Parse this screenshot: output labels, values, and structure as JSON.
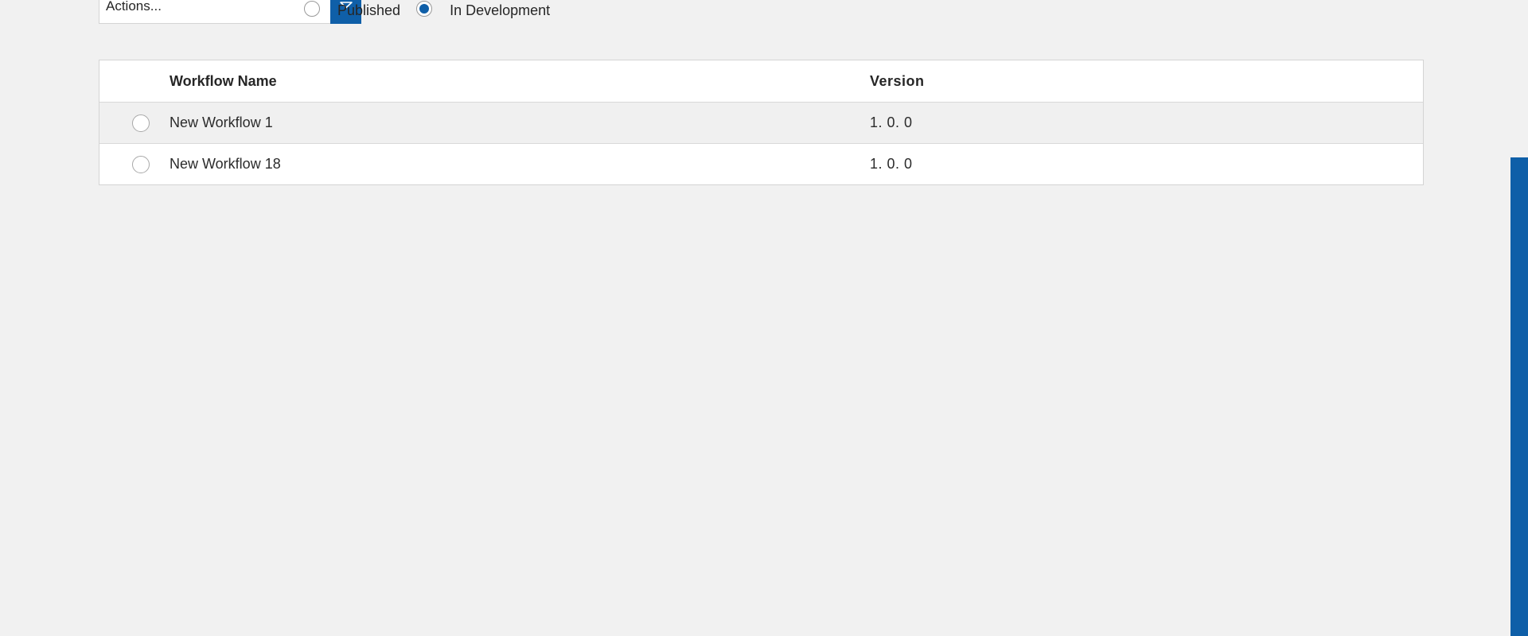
{
  "toolbar": {
    "actions_value": "Actions...",
    "dropdown_icon": "chevron-down-icon",
    "filters": [
      {
        "label": "Published",
        "checked": false
      },
      {
        "label": "In Development",
        "checked": true
      }
    ]
  },
  "table": {
    "columns": {
      "name": "Workflow Name",
      "version": "Version"
    },
    "rows": [
      {
        "name": "New Workflow 1",
        "version": "1. 0. 0"
      },
      {
        "name": "New Workflow 18",
        "version": "1. 0. 0"
      }
    ]
  },
  "colors": {
    "accent": "#0f5fa8",
    "background": "#f1f1f1"
  }
}
